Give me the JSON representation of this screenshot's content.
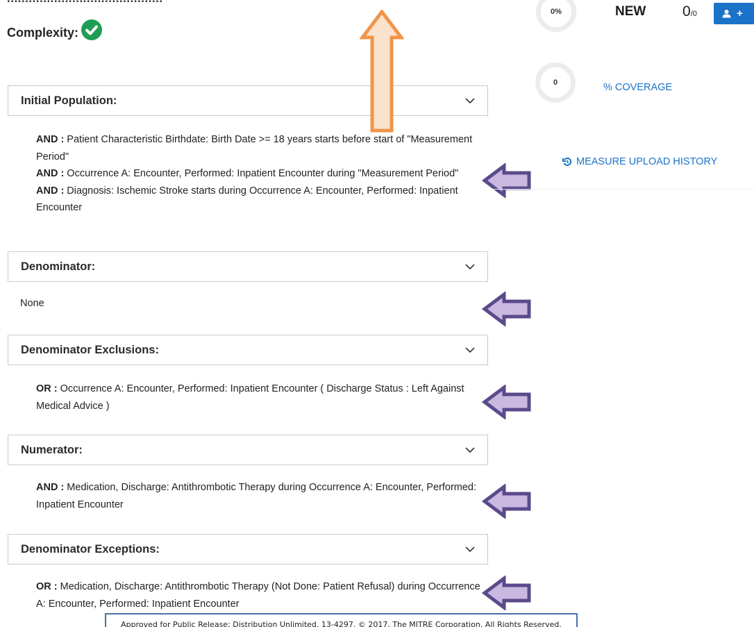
{
  "measure": {
    "title_cut": "...........................................",
    "complexity_label": "Complexity:"
  },
  "sections": [
    {
      "title": "Initial Population:",
      "lines": [
        {
          "op": "AND :",
          "text": " Patient Characteristic Birthdate: Birth Date >= 18 years starts before start of \"Measurement Period\""
        },
        {
          "op": "AND :",
          "text": " Occurrence A: Encounter, Performed: Inpatient Encounter during \"Measurement Period\""
        },
        {
          "op": "AND :",
          "text": " Diagnosis: Ischemic Stroke starts during Occurrence A: Encounter, Performed: Inpatient Encounter"
        }
      ]
    },
    {
      "title": "Denominator:",
      "plain": "None"
    },
    {
      "title": "Denominator Exclusions:",
      "lines": [
        {
          "op": "OR :",
          "text": " Occurrence A: Encounter, Performed: Inpatient Encounter ( Discharge Status : Left Against Medical Advice )"
        }
      ]
    },
    {
      "title": "Numerator:",
      "lines": [
        {
          "op": "AND :",
          "text": " Medication, Discharge: Antithrombotic Therapy during Occurrence A: Encounter, Performed: Inpatient Encounter"
        }
      ]
    },
    {
      "title": "Denominator Exceptions:",
      "lines": [
        {
          "op": "OR :",
          "text": " Medication, Discharge: Antithrombotic Therapy (Not Done: Patient Refusal) during Occurrence A: Encounter, Performed: Inpatient Encounter"
        }
      ]
    }
  ],
  "stats": {
    "percent_ring": "0%",
    "status": "NEW",
    "count_value": "0",
    "count_total": "/0",
    "coverage_ring": "0",
    "coverage_link": "% COVERAGE",
    "upload_history_link": "MEASURE UPLOAD HISTORY",
    "user_button_plus": "+"
  },
  "footer": {
    "text": "Approved for Public Release; Distribution Unlimited. 13-4297. © 2017, The MITRE Corporation. All Rights Reserved."
  },
  "colors": {
    "accent": "#1a73c9",
    "check_green": "#1f9d55",
    "arrow_purple": "#5b4a8b",
    "arrow_fill": "#c9b8e0",
    "arrow_orange": "#f0954a",
    "arrow_orange_fill": "#fbe2cc"
  }
}
